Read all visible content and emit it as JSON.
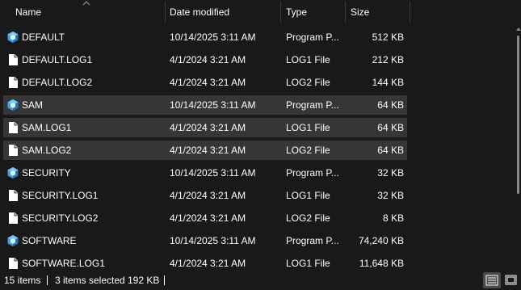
{
  "columns": {
    "name": "Name",
    "date": "Date modified",
    "type": "Type",
    "size": "Size"
  },
  "files": [
    {
      "name": "DEFAULT",
      "date": "10/14/2025 3:11 AM",
      "type": "Program P...",
      "size": "512 KB",
      "icon": "program-file-icon",
      "selected": false
    },
    {
      "name": "DEFAULT.LOG1",
      "date": "4/1/2024 3:21 AM",
      "type": "LOG1 File",
      "size": "212 KB",
      "icon": "document-file-icon",
      "selected": false
    },
    {
      "name": "DEFAULT.LOG2",
      "date": "4/1/2024 3:21 AM",
      "type": "LOG2 File",
      "size": "144 KB",
      "icon": "document-file-icon",
      "selected": false
    },
    {
      "name": "SAM",
      "date": "10/14/2025 3:11 AM",
      "type": "Program P...",
      "size": "64 KB",
      "icon": "program-file-icon",
      "selected": true
    },
    {
      "name": "SAM.LOG1",
      "date": "4/1/2024 3:21 AM",
      "type": "LOG1 File",
      "size": "64 KB",
      "icon": "document-file-icon",
      "selected": true
    },
    {
      "name": "SAM.LOG2",
      "date": "4/1/2024 3:21 AM",
      "type": "LOG2 File",
      "size": "64 KB",
      "icon": "document-file-icon",
      "selected": true
    },
    {
      "name": "SECURITY",
      "date": "10/14/2025 3:11 AM",
      "type": "Program P...",
      "size": "32 KB",
      "icon": "program-file-icon",
      "selected": false
    },
    {
      "name": "SECURITY.LOG1",
      "date": "4/1/2024 3:21 AM",
      "type": "LOG1 File",
      "size": "32 KB",
      "icon": "document-file-icon",
      "selected": false
    },
    {
      "name": "SECURITY.LOG2",
      "date": "4/1/2024 3:21 AM",
      "type": "LOG2 File",
      "size": "8 KB",
      "icon": "document-file-icon",
      "selected": false
    },
    {
      "name": "SOFTWARE",
      "date": "10/14/2025 3:11 AM",
      "type": "Program P...",
      "size": "74,240 KB",
      "icon": "program-file-icon",
      "selected": false
    },
    {
      "name": "SOFTWARE.LOG1",
      "date": "4/1/2024 3:21 AM",
      "type": "LOG1 File",
      "size": "11,648 KB",
      "icon": "document-file-icon",
      "selected": false
    }
  ],
  "status": {
    "item_count": "15 items",
    "selected": "3 items selected",
    "selected_size": "192 KB"
  },
  "colors": {
    "background": "#191919",
    "selected_row": "#363636",
    "program_icon": "#3aa0e8",
    "text": "#ffffff"
  }
}
